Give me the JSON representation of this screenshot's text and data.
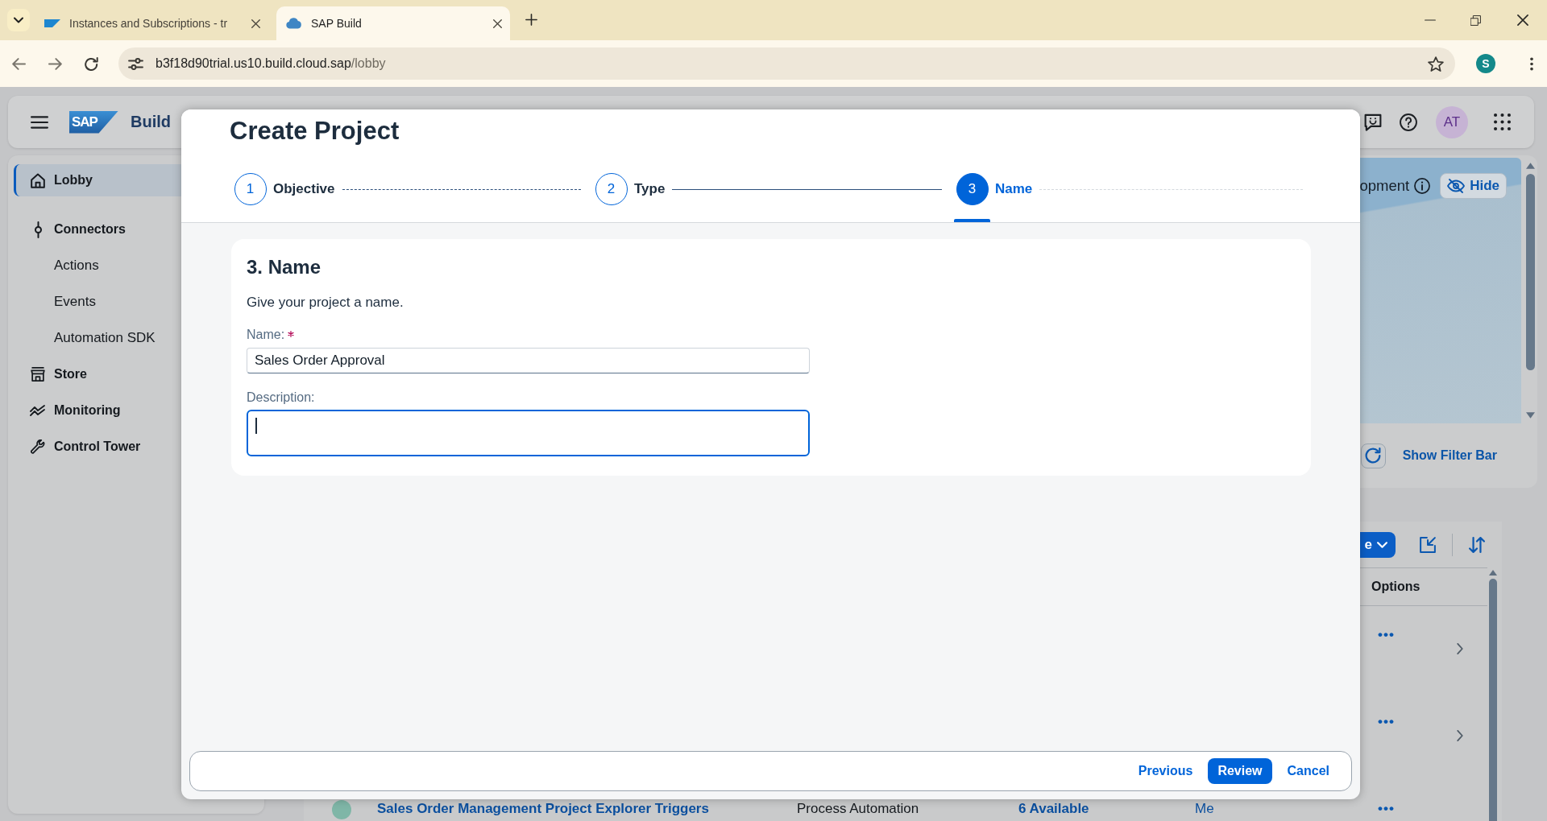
{
  "browser": {
    "tabs": [
      {
        "title": "Instances and Subscriptions - tr",
        "selected": false
      },
      {
        "title": "SAP Build",
        "selected": true
      }
    ],
    "address": {
      "host": "b3f18d90trial.us10.build.cloud.sap",
      "path": "/lobby"
    },
    "profile": "S"
  },
  "app_header": {
    "logo": "SAP",
    "product": "Build",
    "avatar": "AT"
  },
  "sidebar": {
    "items": [
      {
        "label": "Lobby",
        "selected": true
      },
      {
        "label": "Connectors",
        "selected": false,
        "children": [
          {
            "label": "Actions",
            "selected": false
          },
          {
            "label": "Events",
            "selected": false
          },
          {
            "label": "Automation SDK",
            "selected": false
          }
        ]
      },
      {
        "label": "Store",
        "selected": false
      },
      {
        "label": "Monitoring",
        "selected": false
      },
      {
        "label": "Control Tower",
        "selected": false
      }
    ]
  },
  "banner": {
    "heading": "opment",
    "hide_button": "Hide"
  },
  "filter_bar": {
    "toggle": "Show Filter Bar"
  },
  "table": {
    "create_button": "e",
    "columns": [
      {
        "label": "Options"
      }
    ],
    "rows": [
      {
        "actions": "•••",
        "navigable": true
      },
      {
        "actions": "•••",
        "navigable": true
      },
      {
        "name": "Sales Order Management Project Explorer Triggers",
        "type": "Process Automation",
        "availability": "6 Available",
        "owner": "Me",
        "actions": "•••"
      }
    ]
  },
  "dialog": {
    "title": "Create Project",
    "steps": [
      {
        "number": "1",
        "label": "Objective",
        "selected": false
      },
      {
        "number": "2",
        "label": "Type",
        "selected": false
      },
      {
        "number": "3",
        "label": "Name",
        "selected": true
      }
    ],
    "section": {
      "title": "3. Name",
      "description": "Give your project a name.",
      "fields": [
        {
          "kind": "input",
          "label": "Name:",
          "required": true,
          "value": "Sales Order Approval",
          "focused": false
        },
        {
          "kind": "textarea",
          "label": "Description:",
          "required": false,
          "focused": true
        }
      ]
    },
    "footer_buttons": [
      {
        "label": "Previous",
        "kind": "transparent"
      },
      {
        "label": "Review",
        "kind": "emphasized"
      },
      {
        "label": "Cancel",
        "kind": "transparent"
      }
    ]
  }
}
